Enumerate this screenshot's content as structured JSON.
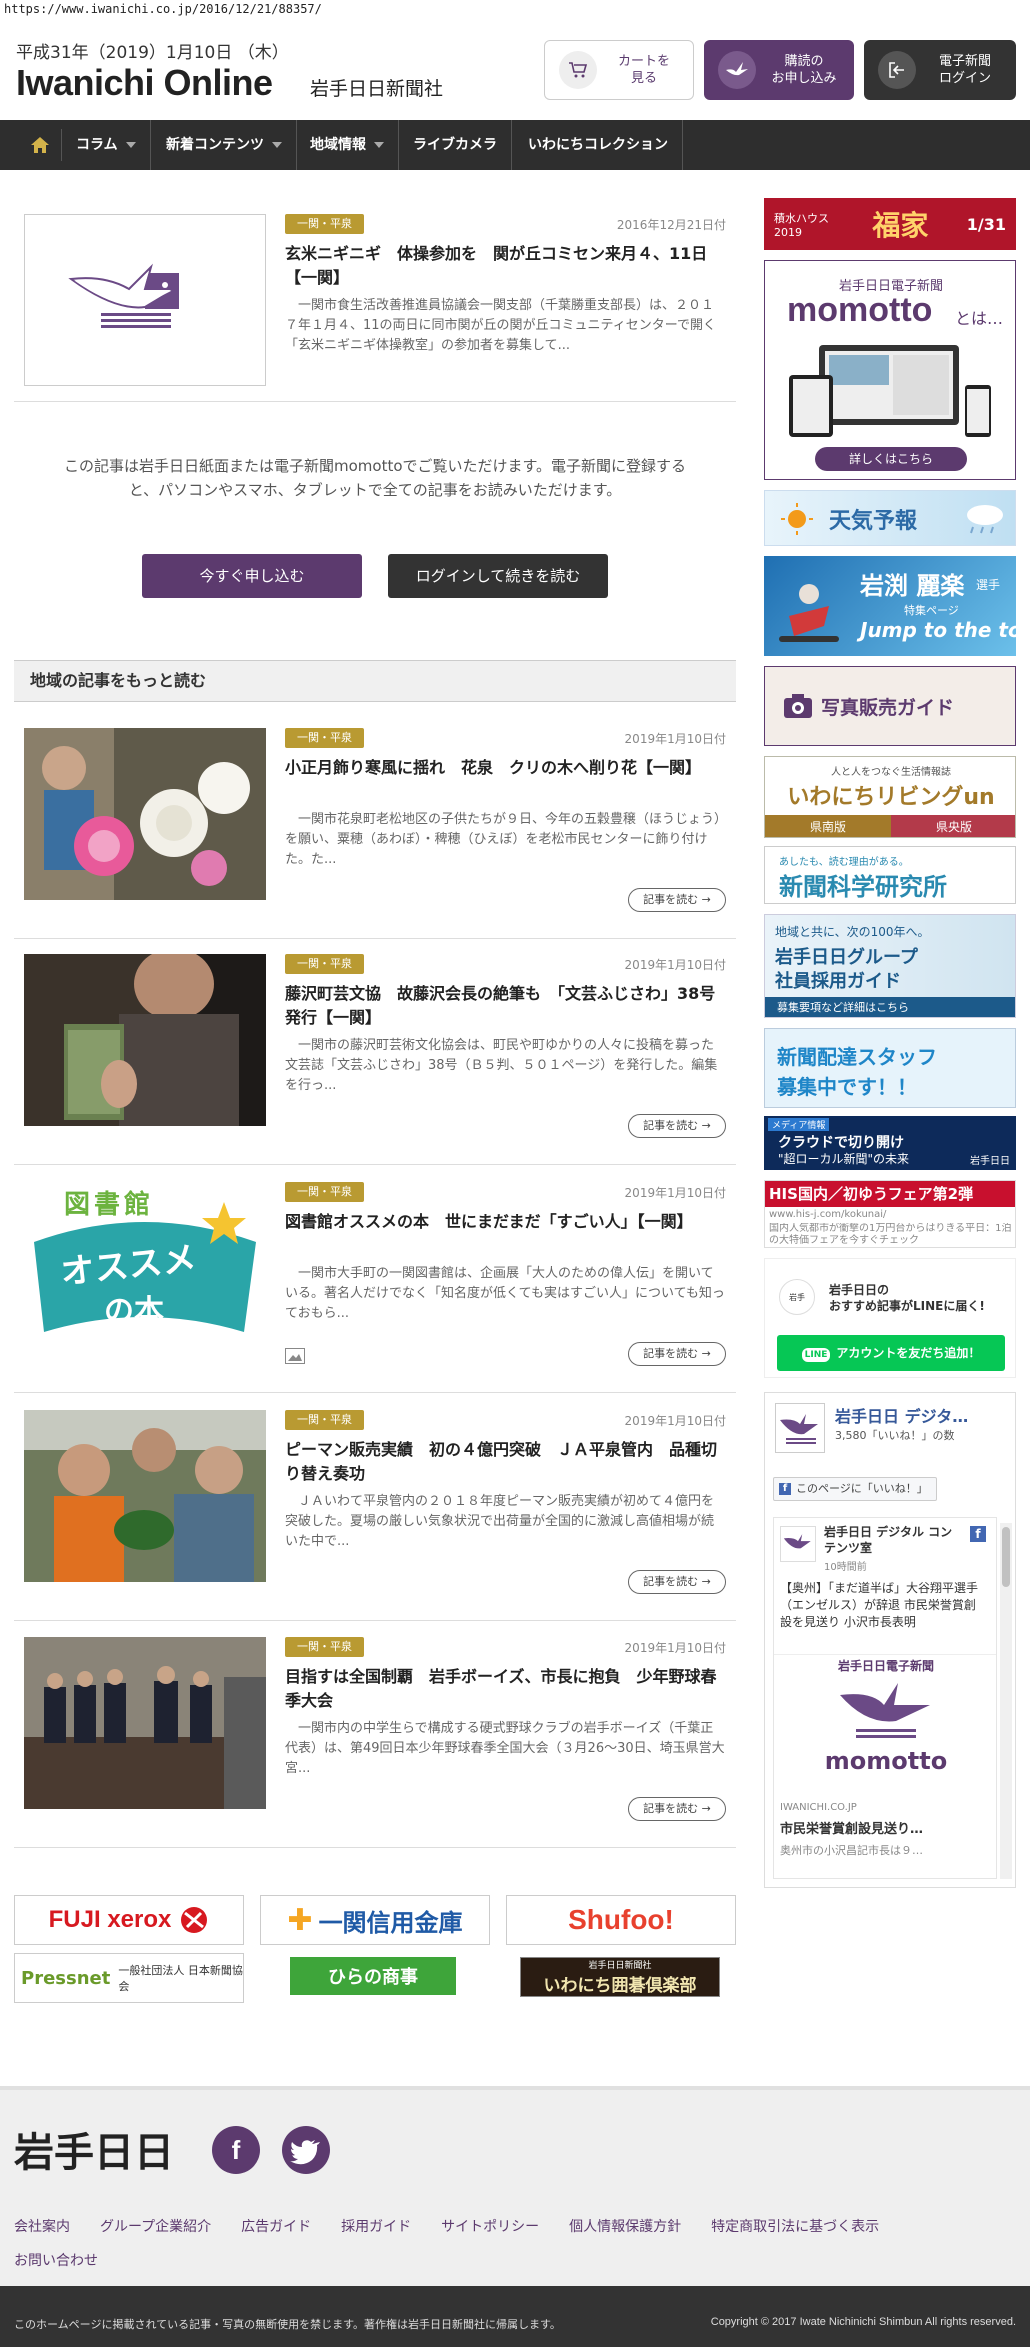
{
  "browser": {
    "url": "https://www.iwanichi.co.jp/2016/12/21/88357/"
  },
  "header": {
    "date": "平成31年（2019）1月10日 （木）",
    "logo": "Iwanichi Online",
    "logo_sub": "岩手日日新聞社",
    "cart_label": "カートを\n見る",
    "subscribe_label": "購読の\nお申し込み",
    "login_label": "電子新聞\nログイン"
  },
  "nav": {
    "items": [
      "コラム",
      "新着コンテンツ",
      "地域情報",
      "ライブカメラ",
      "いわにちコレクション"
    ]
  },
  "featured": {
    "tag": "一関・平泉",
    "date": "2016年12月21日付",
    "title": "玄米ニギニギ　体操参加を　関が丘コミセン来月４、11日【一関】",
    "body": "一関市食生活改善推進員協議会一関支部（千葉勝重支部長）は、２０１７年１月４、11の両日に同市関が丘の関が丘コミュニティセンターで開く「玄米ニギニギ体操教室」の参加者を募集して..."
  },
  "paywall": {
    "text": "この記事は岩手日日紙面または電子新聞momottoでご覧いただけます。電子新聞に登録すると、パソコンやスマホ、タブレットで全ての記事をお読みいただけます。",
    "subscribe_button": "今すぐ申し込む",
    "login_button": "ログインして続きを読む"
  },
  "section": {
    "title": "地域の記事をもっと読む"
  },
  "articles": [
    {
      "tag": "一関・平泉",
      "date": "2019年1月10日付",
      "title": "小正月飾り寒風に揺れ　花泉　クリの木へ削り花【一関】",
      "body": "一関市花泉町老松地区の子供たちが９日、今年の五穀豊穣（ほうじょう）を願い、粟穂（あわぼ）・稗穂（ひえぼ）を老松市民センターに飾り付けた。た...",
      "more": "記事を読む"
    },
    {
      "tag": "一関・平泉",
      "date": "2019年1月10日付",
      "title": "藤沢町芸文協　故藤沢会長の絶筆も　「文芸ふじさわ」38号発行【一関】",
      "body": "一関市の藤沢町芸術文化協会は、町民や町ゆかりの人々に投稿を募った文芸誌「文芸ふじさわ」38号（Ｂ５判、５０１ページ）を発行した。編集を行っ...",
      "more": "記事を読む"
    },
    {
      "tag": "一関・平泉",
      "date": "2019年1月10日付",
      "title": "図書館オススメの本　世にまだまだ「すごい人」【一関】",
      "body": "一関市大手町の一関図書館は、企画展「大人のための偉人伝」を開いている。著名人だけでなく「知名度が低くても実はすごい人」についても知っておもら...",
      "more": "記事を読む"
    },
    {
      "tag": "一関・平泉",
      "date": "2019年1月10日付",
      "title": "ピーマン販売実績　初の４億円突破　ＪＡ平泉管内　品種切り替え奏功",
      "body": "ＪＡいわて平泉管内の２０１８年度ピーマン販売実績が初めて４億円を突破した。夏場の厳しい気象状況で出荷量が全国的に激減し高値相場が続いた中で...",
      "more": "記事を読む"
    },
    {
      "tag": "一関・平泉",
      "date": "2019年1月10日付",
      "title": "目指すは全国制覇　岩手ボーイズ、市長に抱負　少年野球春季大会",
      "body": "一関市内の中学生らで構成する硬式野球クラブの岩手ボーイズ（千葉正代表）は、第49回日本少年野球春季全国大会（３月26～30日、埼玉県営大宮...",
      "more": "記事を読む"
    }
  ],
  "thumb_text": {
    "library_top": "図書館",
    "library_mid": "オススメ",
    "library_bot": "の本"
  },
  "sidebar": {
    "ad1_left": "積水ハウス 2019",
    "ad1_mid": "福家",
    "ad1_right": "1/31",
    "momotto_top": "岩手日日電子新聞",
    "momotto_logo": "momotto",
    "momotto_suffix": "とは…",
    "momotto_btn": "詳しくはこちら",
    "weather": "天気予報",
    "iwabuchi_name": "岩渕 麗楽",
    "iwabuchi_sub": "選手",
    "iwabuchi_special": "特集ページ",
    "iwabuchi_tag": "Jump to the top",
    "photo": "写真販売ガイド",
    "living_top": "人と人をつなぐ生活情報誌",
    "living_logo": "いわにちリビングun",
    "living_a": "県南版",
    "living_b": "県央版",
    "kagaku_top": "あしたも、読む理由がある。",
    "kagaku": "新聞科学研究所",
    "recruit_top": "地域と共に、次の100年へ。",
    "recruit_1": "岩手日日グループ",
    "recruit_2": "社員採用ガイド",
    "recruit_3": "募集要項など詳細はこちら",
    "delivery_1": "新聞配達スタッフ",
    "delivery_2": "募集中です！！",
    "cloud_tag": "メディア情報",
    "cloud_1": "クラウドで切り開け",
    "cloud_2": "\"超ローカル新聞\"の未来",
    "cloud_brand": "岩手日日",
    "his_title": "HIS国内／初ゆうフェア第2弾",
    "his_url": "www.his-j.com/kokunai/",
    "his_body": "国内人気都市が衝撃の1万円台からはりきる平日：1泊の大特価フェアを今すぐチェック",
    "line_1": "岩手日日の",
    "line_2": "おすすめ記事がLINEに届く!",
    "line_btn": "アカウントを友だち追加！",
    "fb_page": "岩手日日 デジタ…",
    "fb_likes": "3,580「いいね！」の数",
    "fb_like_btn": "このページに「いいね！」",
    "fb_post_name": "岩手日日 デジタル コンテンツ室",
    "fb_post_time": "10時間前",
    "fb_post_text": "【奥州】「まだ道半ば」大谷翔平選手（エンゼルス）が辞退 市民栄誉賞創設を見送り 小沢市長表明",
    "fb_card_top": "岩手日日電子新聞",
    "fb_card_logo": "momotto",
    "fb_card_domain": "IWANICHI.CO.JP",
    "fb_card_title": "市民栄誉賞創設見送り…",
    "fb_card_desc": "奥州市の小沢昌記市長は９…"
  },
  "partner_banners": {
    "fujixerox": "FUJI xerox",
    "ichinoseki": "一関信用金庫",
    "shufoo": "Shufoo!",
    "pressnet": "Pressnet",
    "pressnet_sub": "一般社団法人 日本新聞協会",
    "hirano": "ひらの商事",
    "go_club": "いわにち囲碁倶楽部",
    "go_club_top": "岩手日日新聞社"
  },
  "footer": {
    "logo": "岩手日日",
    "links": [
      "会社案内",
      "グループ企業紹介",
      "広告ガイド",
      "採用ガイド",
      "サイトポリシー",
      "個人情報保護方針",
      "特定商取引法に基づく表示",
      "お問い合わせ"
    ],
    "notice": "このホームページに掲載されている記事・写真の無断使用を禁じます。著作権は岩手日日新聞社に帰属します。",
    "copyright": "Copyright © 2017 Iwate Nichinichi Shimbun All rights reserved."
  },
  "colors": {
    "brand_purple": "#5c3a6e",
    "tag_gold": "#b99a32",
    "nav_dark": "#2e2e2e",
    "line_green": "#06c755"
  }
}
